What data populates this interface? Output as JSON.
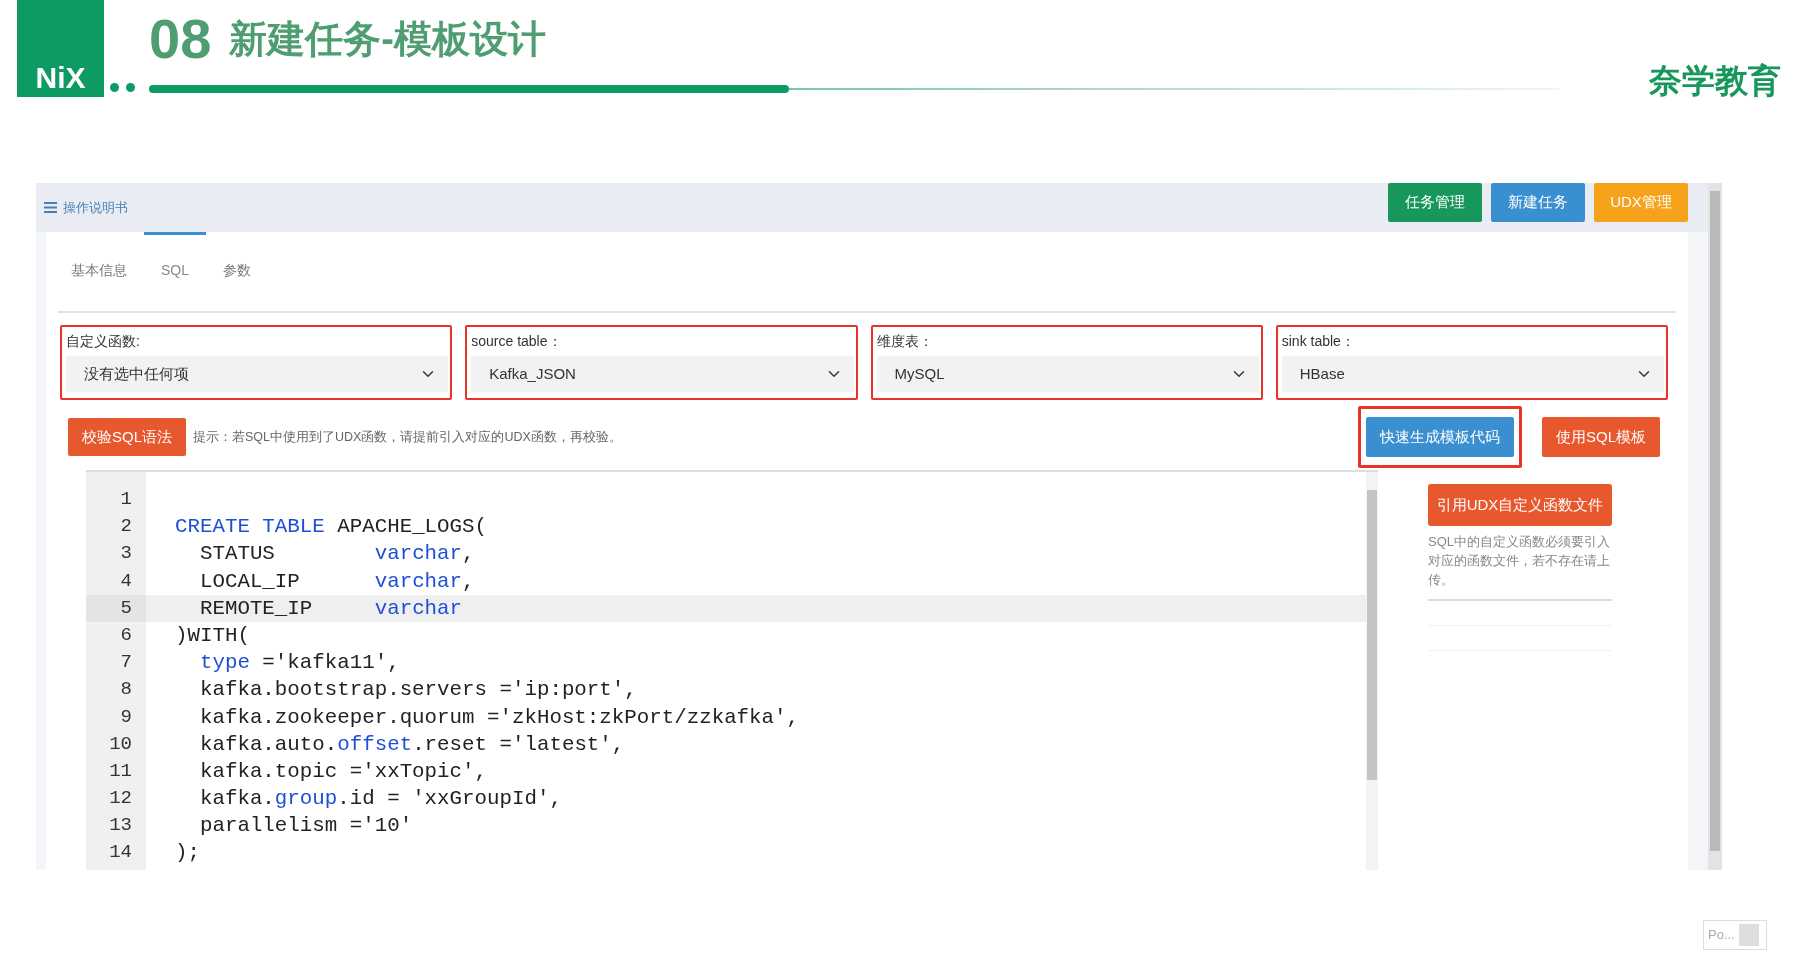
{
  "slide": {
    "logo": "NiX",
    "number": "08",
    "title": "新建任务-模板设计",
    "brand": "奈学教育"
  },
  "app": {
    "menu_label": "操作说明书",
    "top_buttons": [
      {
        "label": "任务管理",
        "color": "#17975b"
      },
      {
        "label": "新建任务",
        "color": "#3a8fd0"
      },
      {
        "label": "UDX管理",
        "color": "#f7a21b"
      }
    ],
    "tabs": [
      {
        "label": "基本信息",
        "selected": false
      },
      {
        "label": "SQL",
        "selected": true
      },
      {
        "label": "参数",
        "selected": false
      }
    ],
    "fields": [
      {
        "label": "自定义函数:",
        "value": "没有选中任何项",
        "highlighted": true
      },
      {
        "label": "source table：",
        "value": "Kafka_JSON",
        "highlighted": true
      },
      {
        "label": "维度表：",
        "value": "MySQL",
        "highlighted": true
      },
      {
        "label": "sink table：",
        "value": "HBase",
        "highlighted": true
      }
    ],
    "validate_button": "校验SQL语法",
    "hint": "提示：若SQL中使用到了UDX函数，请提前引入对应的UDX函数，再校验。",
    "action_buttons": [
      {
        "label": "快速生成模板代码",
        "color": "#3a8fd0",
        "highlighted": true
      },
      {
        "label": "使用SQL模板",
        "color": "#e8582f",
        "highlighted": false
      }
    ],
    "code_lines": [
      {
        "number": "1",
        "current": false
      },
      {
        "number": "2",
        "current": false,
        "tokens": [
          {
            "text": "CREATE TABLE",
            "kind": "keyword"
          },
          {
            "text": " APACHE_LOGS(",
            "kind": "plain"
          }
        ]
      },
      {
        "number": "3",
        "current": false,
        "tokens": [
          {
            "text": "  STATUS        ",
            "kind": "plain"
          },
          {
            "text": "varchar",
            "kind": "keyword"
          },
          {
            "text": ",",
            "kind": "plain"
          }
        ]
      },
      {
        "number": "4",
        "current": false,
        "tokens": [
          {
            "text": "  LOCAL_IP      ",
            "kind": "plain"
          },
          {
            "text": "varchar",
            "kind": "keyword"
          },
          {
            "text": ",",
            "kind": "plain"
          }
        ]
      },
      {
        "number": "5",
        "current": true,
        "tokens": [
          {
            "text": "  REMOTE_IP     ",
            "kind": "plain"
          },
          {
            "text": "varchar",
            "kind": "keyword"
          }
        ]
      },
      {
        "number": "6",
        "current": false,
        "tokens": [
          {
            "text": ")WITH(",
            "kind": "plain"
          }
        ]
      },
      {
        "number": "7",
        "current": false,
        "indented": true,
        "tokens": [
          {
            "text": "type",
            "kind": "keyword"
          },
          {
            "text": " ='kafka11',",
            "kind": "plain"
          }
        ]
      },
      {
        "number": "8",
        "current": false,
        "tokens": [
          {
            "text": "  kafka.bootstrap.servers ='ip:port',",
            "kind": "plain"
          }
        ]
      },
      {
        "number": "9",
        "current": false,
        "tokens": [
          {
            "text": "  kafka.zookeeper.quorum ='zkHost:zkPort/zzkafka',",
            "kind": "plain"
          }
        ]
      },
      {
        "number": "10",
        "current": false,
        "tokens": [
          {
            "text": "  kafka.auto.",
            "kind": "plain"
          },
          {
            "text": "offset",
            "kind": "keyword"
          },
          {
            "text": ".reset ='latest',",
            "kind": "plain"
          }
        ]
      },
      {
        "number": "11",
        "current": false,
        "tokens": [
          {
            "text": "  kafka.topic ='xxTopic',",
            "kind": "plain"
          }
        ]
      },
      {
        "number": "12",
        "current": false,
        "tokens": [
          {
            "text": "  kafka.",
            "kind": "plain"
          },
          {
            "text": "group",
            "kind": "keyword"
          },
          {
            "text": ".id = 'xxGroupId',",
            "kind": "plain"
          }
        ]
      },
      {
        "number": "13",
        "current": false,
        "tokens": [
          {
            "text": "  parallelism ='10'",
            "kind": "plain"
          }
        ]
      },
      {
        "number": "14",
        "current": false,
        "tokens": [
          {
            "text": ");",
            "kind": "plain"
          }
        ]
      }
    ],
    "side_button": "引用UDX自定义函数文件",
    "side_note": "SQL中的自定义函数必须要引入对应的函数文件，若不存在请上传。"
  },
  "popup": {
    "label": "Po..."
  }
}
